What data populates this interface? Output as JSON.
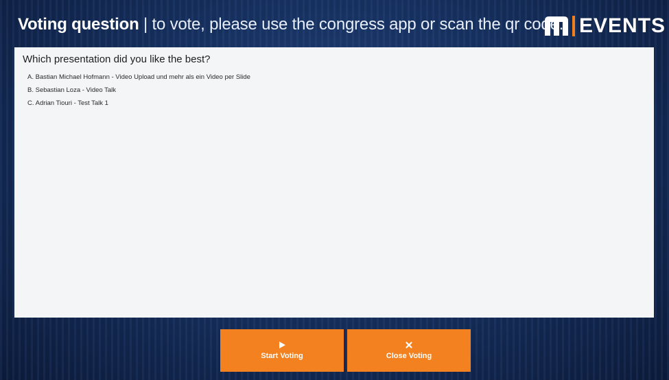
{
  "header": {
    "title_bold": "Voting question",
    "title_rest": " | to vote, please use the congress app or scan the qr code.",
    "logo_text": "EVENTS",
    "logo_mark": "m-logo-icon"
  },
  "question": {
    "text": "Which presentation did you like the best?",
    "answers": [
      "A. Bastian Michael Hofmann - Video Upload und mehr als ein Video per Slide",
      "B. Sebastian Loza - Video Talk",
      "C. Adrian Tiouri - Test Talk 1"
    ]
  },
  "buttons": {
    "start": {
      "label": "Start Voting",
      "icon": "play-icon"
    },
    "close": {
      "label": "Close Voting",
      "icon": "close-icon"
    }
  },
  "colors": {
    "accent_orange": "#f4811f",
    "background_blue": "#16305e",
    "panel_bg": "#f4f5f7"
  }
}
